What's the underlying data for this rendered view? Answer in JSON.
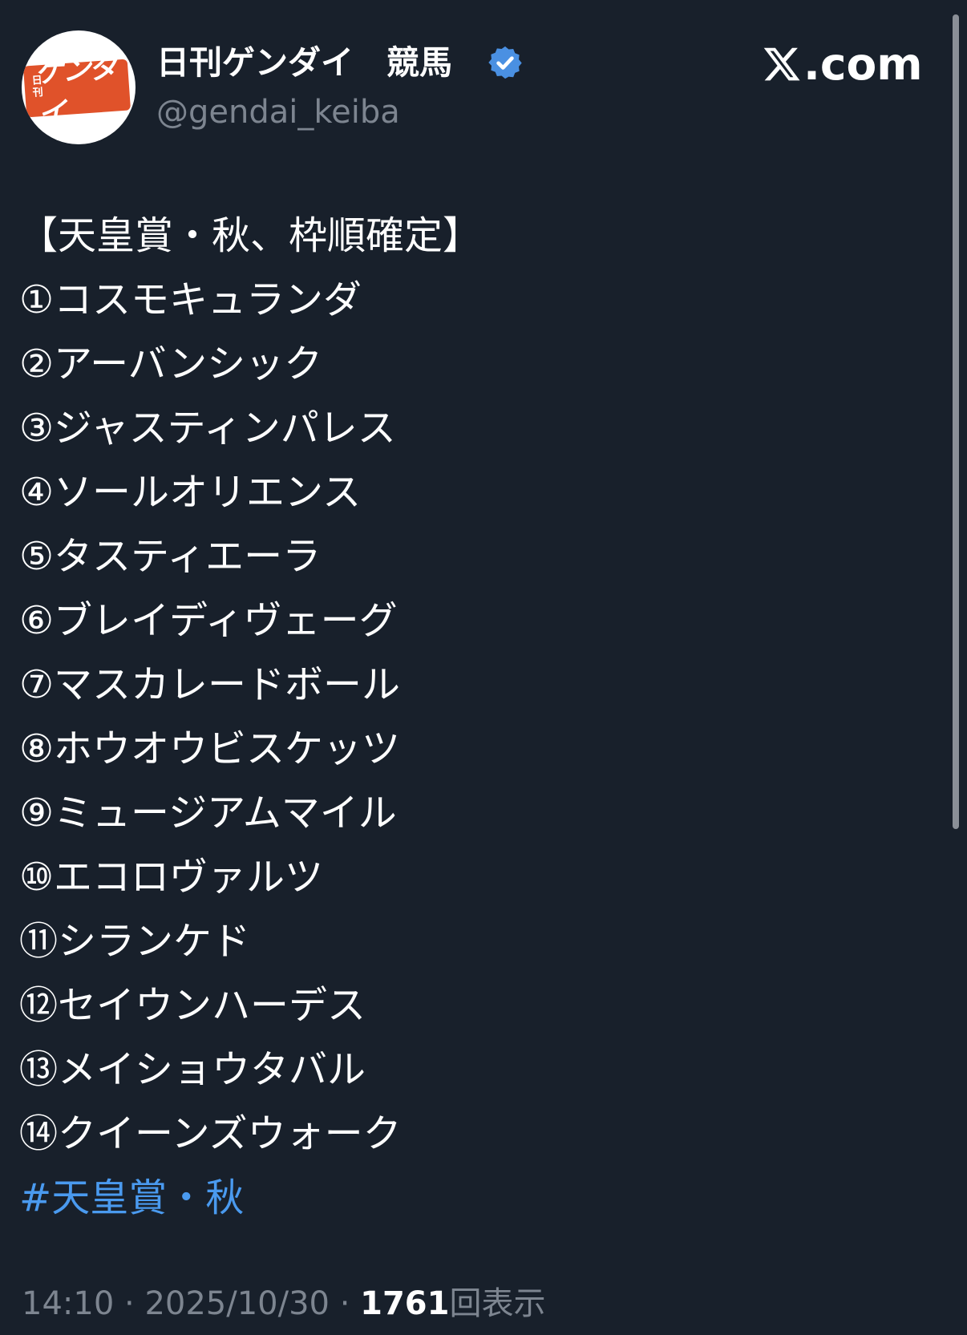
{
  "colors": {
    "background": "#18202b",
    "text": "#ffffff",
    "muted": "#7d8590",
    "hashtag": "#4a9aef",
    "verified": "#4a90e2",
    "avatar_badge": "#e0522a"
  },
  "header": {
    "avatar": {
      "small_text": "日刊",
      "main_text": "ゲンダイ",
      "icon": "account-avatar"
    },
    "author_name": "日刊ゲンダイ　競馬",
    "verified_icon": "verified-badge-icon",
    "handle": "@gendai_keiba",
    "brand": {
      "icon": "x-logo-icon",
      "suffix": ".com"
    }
  },
  "tweet": {
    "heading": "【天皇賞・秋、枠順確定】",
    "entries": [
      "①コスモキュランダ",
      "②アーバンシック",
      "③ジャスティンパレス",
      "④ソールオリエンス",
      "⑤タスティエーラ",
      "⑥ブレイディヴェーグ",
      "⑦マスカレードボール",
      "⑧ホウオウビスケッツ",
      "⑨ミュージアムマイル",
      "⑩エコロヴァルツ",
      "⑪シランケド",
      "⑫セイウンハーデス",
      "⑬メイショウタバル",
      "⑭クイーンズウォーク"
    ],
    "hashtag": "#天皇賞・秋"
  },
  "meta": {
    "time": "14:10",
    "separator": " · ",
    "date": "2025/10/30",
    "views_count": "1761",
    "views_label": "回表示"
  }
}
